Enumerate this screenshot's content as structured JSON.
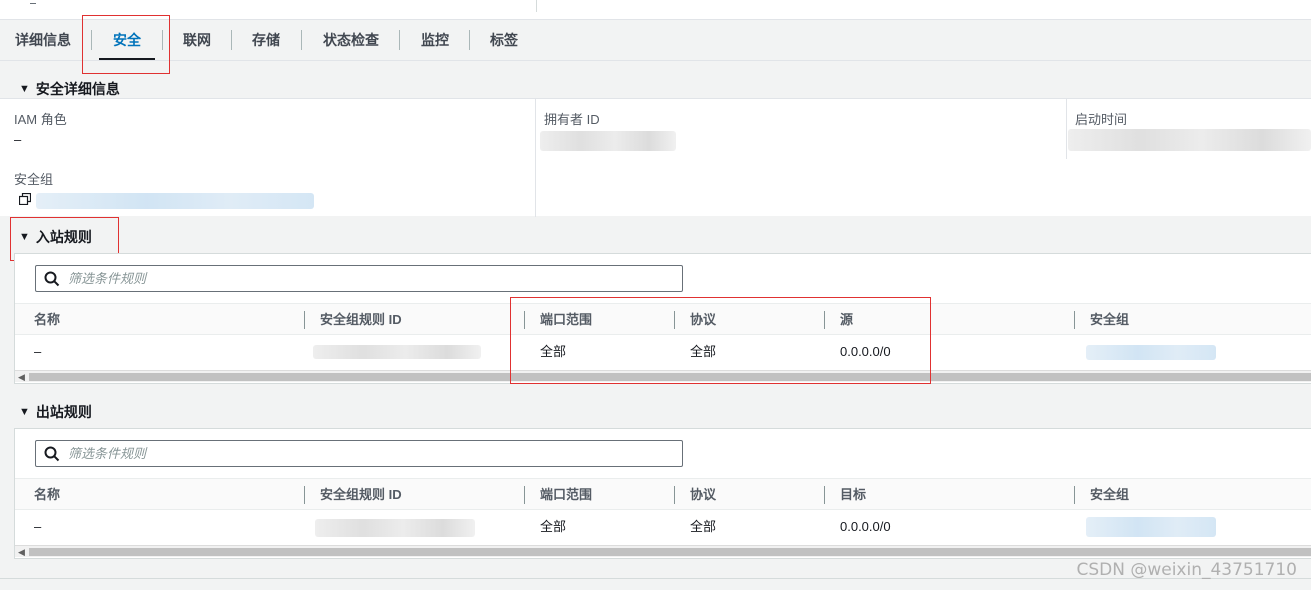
{
  "tabs": [
    {
      "label": "详细信息",
      "active": false
    },
    {
      "label": "安全",
      "active": true
    },
    {
      "label": "联网",
      "active": false
    },
    {
      "label": "存储",
      "active": false
    },
    {
      "label": "状态检查",
      "active": false
    },
    {
      "label": "监控",
      "active": false
    },
    {
      "label": "标签",
      "active": false
    }
  ],
  "security_details": {
    "heading": "安全详细信息",
    "iam_role_label": "IAM 角色",
    "iam_role_value": "–",
    "owner_id_label": "拥有者 ID",
    "launch_time_label": "启动时间",
    "security_group_label": "安全组"
  },
  "inbound": {
    "heading": "入站规则",
    "filter_placeholder": "筛选条件规则",
    "columns": [
      "名称",
      "安全组规则 ID",
      "端口范围",
      "协议",
      "源",
      "安全组"
    ],
    "row": {
      "name": "–",
      "port_range": "全部",
      "protocol": "全部",
      "source": "0.0.0.0/0"
    }
  },
  "outbound": {
    "heading": "出站规则",
    "filter_placeholder": "筛选条件规则",
    "columns": [
      "名称",
      "安全组规则 ID",
      "端口范围",
      "协议",
      "目标",
      "安全组"
    ],
    "row": {
      "name": "–",
      "port_range": "全部",
      "protocol": "全部",
      "destination": "0.0.0.0/0"
    }
  },
  "watermark": "CSDN @weixin_43751710",
  "colors": {
    "accent": "#0073bb",
    "highlight_box": "#e03131"
  },
  "icons": {
    "section_toggle": "caret-down-icon",
    "filter": "search-icon",
    "copy": "copy-icon"
  }
}
